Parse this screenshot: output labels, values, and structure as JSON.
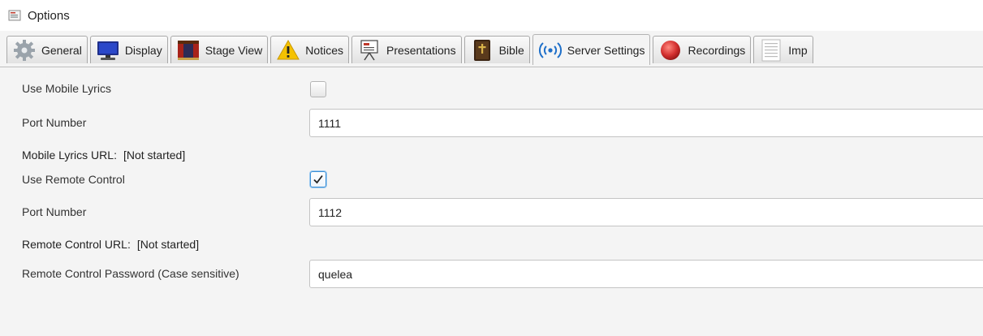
{
  "window": {
    "title": "Options"
  },
  "tabs": [
    {
      "label": "General",
      "icon": "gear-icon",
      "active": false
    },
    {
      "label": "Display",
      "icon": "monitor-icon",
      "active": false
    },
    {
      "label": "Stage View",
      "icon": "stage-icon",
      "active": false
    },
    {
      "label": "Notices",
      "icon": "warning-icon",
      "active": false
    },
    {
      "label": "Presentations",
      "icon": "presentation-icon",
      "active": false
    },
    {
      "label": "Bible",
      "icon": "bible-icon",
      "active": false
    },
    {
      "label": "Server Settings",
      "icon": "broadcast-icon",
      "active": true
    },
    {
      "label": "Recordings",
      "icon": "record-icon",
      "active": false
    },
    {
      "label": "Imp",
      "icon": "document-icon",
      "active": false
    }
  ],
  "server": {
    "use_mobile_lyrics_label": "Use Mobile Lyrics",
    "use_mobile_lyrics_checked": false,
    "mobile_port_label": "Port Number",
    "mobile_port_value": "1111",
    "mobile_url_label": "Mobile Lyrics URL:",
    "mobile_url_value": "[Not started]",
    "use_remote_control_label": "Use Remote Control",
    "use_remote_control_checked": true,
    "remote_port_label": "Port Number",
    "remote_port_value": "1112",
    "remote_url_label": "Remote Control URL:",
    "remote_url_value": "[Not started]",
    "remote_password_label": "Remote Control Password (Case sensitive)",
    "remote_password_value": "quelea"
  },
  "colors": {
    "accent": "#3b8fd6",
    "background": "#f4f4f4",
    "field_border": "#c4c4c4"
  }
}
